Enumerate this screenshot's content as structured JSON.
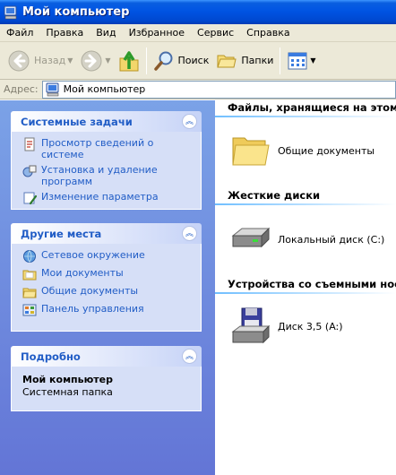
{
  "window": {
    "title": "Мой компьютер"
  },
  "menu": [
    "Файл",
    "Правка",
    "Вид",
    "Избранное",
    "Сервис",
    "Справка"
  ],
  "toolbar": {
    "back": "Назад",
    "search": "Поиск",
    "folders": "Папки"
  },
  "address": {
    "label": "Адрес:",
    "value": "Мой компьютер"
  },
  "panels": {
    "system_tasks": {
      "title": "Системные задачи",
      "items": [
        "Просмотр сведений о системе",
        "Установка и удаление программ",
        "Изменение параметра"
      ]
    },
    "other_places": {
      "title": "Другие места",
      "items": [
        "Сетевое окружение",
        "Мои документы",
        "Общие документы",
        "Панель управления"
      ]
    },
    "details": {
      "title": "Подробно",
      "name": "Мой компьютер",
      "type": "Системная папка"
    }
  },
  "groups": {
    "files": {
      "title": "Файлы, хранящиеся на этом компьютере",
      "items": [
        "Общие документы"
      ]
    },
    "hard_drives": {
      "title": "Жесткие диски",
      "items": [
        "Локальный диск (C:)"
      ]
    },
    "removable": {
      "title": "Устройства со съемными носителями",
      "items": [
        "Диск 3,5 (A:)"
      ]
    }
  },
  "colors": {
    "titlebar": "#0054e3",
    "panel_link": "#215dc6",
    "leftpane_top": "#7ba2e7",
    "leftpane_bottom": "#6375d6"
  }
}
